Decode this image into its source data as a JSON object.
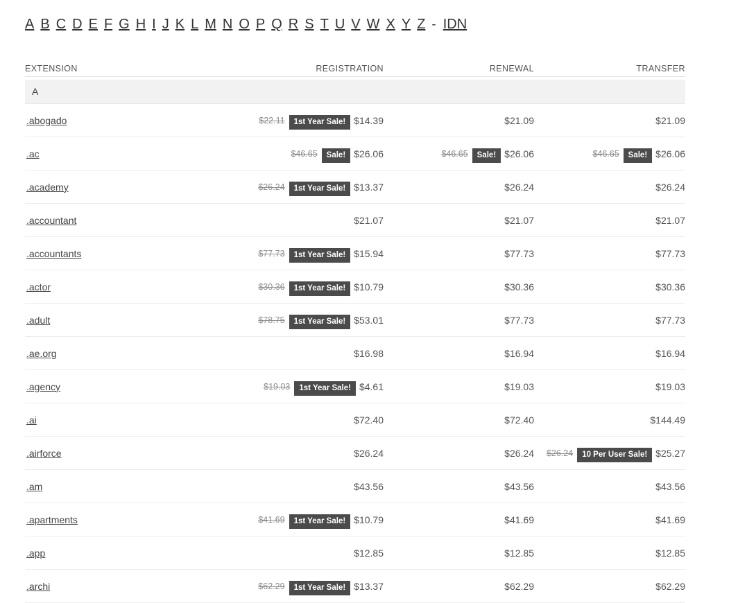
{
  "alpha_nav": {
    "letters": [
      "A",
      "B",
      "C",
      "D",
      "E",
      "F",
      "G",
      "H",
      "I",
      "J",
      "K",
      "L",
      "M",
      "N",
      "O",
      "P",
      "Q",
      "R",
      "S",
      "T",
      "U",
      "V",
      "W",
      "X",
      "Y",
      "Z"
    ],
    "separator": "-",
    "idn_label": "IDN"
  },
  "table": {
    "headers": {
      "extension": "EXTENSION",
      "registration": "REGISTRATION",
      "renewal": "RENEWAL",
      "transfer": "TRANSFER"
    },
    "section_letter": "A",
    "badge_colors": {
      "background": "#4b4b4b",
      "text": "#ffffff"
    },
    "rows": [
      {
        "extension": ".abogado",
        "registration": {
          "old": "$22.11",
          "badge": "1st Year Sale!",
          "price": "$14.39"
        },
        "renewal": {
          "old": null,
          "badge": null,
          "price": "$21.09"
        },
        "transfer": {
          "old": null,
          "badge": null,
          "price": "$21.09"
        }
      },
      {
        "extension": ".ac",
        "registration": {
          "old": "$46.65",
          "badge": "Sale!",
          "price": "$26.06"
        },
        "renewal": {
          "old": "$46.65",
          "badge": "Sale!",
          "price": "$26.06"
        },
        "transfer": {
          "old": "$46.65",
          "badge": "Sale!",
          "price": "$26.06"
        }
      },
      {
        "extension": ".academy",
        "registration": {
          "old": "$26.24",
          "badge": "1st Year Sale!",
          "price": "$13.37"
        },
        "renewal": {
          "old": null,
          "badge": null,
          "price": "$26.24"
        },
        "transfer": {
          "old": null,
          "badge": null,
          "price": "$26.24"
        }
      },
      {
        "extension": ".accountant",
        "registration": {
          "old": null,
          "badge": null,
          "price": "$21.07"
        },
        "renewal": {
          "old": null,
          "badge": null,
          "price": "$21.07"
        },
        "transfer": {
          "old": null,
          "badge": null,
          "price": "$21.07"
        }
      },
      {
        "extension": ".accountants",
        "registration": {
          "old": "$77.73",
          "badge": "1st Year Sale!",
          "price": "$15.94"
        },
        "renewal": {
          "old": null,
          "badge": null,
          "price": "$77.73"
        },
        "transfer": {
          "old": null,
          "badge": null,
          "price": "$77.73"
        }
      },
      {
        "extension": ".actor",
        "registration": {
          "old": "$30.36",
          "badge": "1st Year Sale!",
          "price": "$10.79"
        },
        "renewal": {
          "old": null,
          "badge": null,
          "price": "$30.36"
        },
        "transfer": {
          "old": null,
          "badge": null,
          "price": "$30.36"
        }
      },
      {
        "extension": ".adult",
        "registration": {
          "old": "$78.75",
          "badge": "1st Year Sale!",
          "price": "$53.01"
        },
        "renewal": {
          "old": null,
          "badge": null,
          "price": "$77.73"
        },
        "transfer": {
          "old": null,
          "badge": null,
          "price": "$77.73"
        }
      },
      {
        "extension": ".ae.org",
        "registration": {
          "old": null,
          "badge": null,
          "price": "$16.98"
        },
        "renewal": {
          "old": null,
          "badge": null,
          "price": "$16.94"
        },
        "transfer": {
          "old": null,
          "badge": null,
          "price": "$16.94"
        }
      },
      {
        "extension": ".agency",
        "registration": {
          "old": "$19.03",
          "badge": "1st Year Sale!",
          "price": "$4.61"
        },
        "renewal": {
          "old": null,
          "badge": null,
          "price": "$19.03"
        },
        "transfer": {
          "old": null,
          "badge": null,
          "price": "$19.03"
        }
      },
      {
        "extension": ".ai",
        "registration": {
          "old": null,
          "badge": null,
          "price": "$72.40"
        },
        "renewal": {
          "old": null,
          "badge": null,
          "price": "$72.40"
        },
        "transfer": {
          "old": null,
          "badge": null,
          "price": "$144.49"
        }
      },
      {
        "extension": ".airforce",
        "registration": {
          "old": null,
          "badge": null,
          "price": "$26.24"
        },
        "renewal": {
          "old": null,
          "badge": null,
          "price": "$26.24"
        },
        "transfer": {
          "old": "$26.24",
          "badge": "10 Per User Sale!",
          "price": "$25.27"
        }
      },
      {
        "extension": ".am",
        "registration": {
          "old": null,
          "badge": null,
          "price": "$43.56"
        },
        "renewal": {
          "old": null,
          "badge": null,
          "price": "$43.56"
        },
        "transfer": {
          "old": null,
          "badge": null,
          "price": "$43.56"
        }
      },
      {
        "extension": ".apartments",
        "registration": {
          "old": "$41.69",
          "badge": "1st Year Sale!",
          "price": "$10.79"
        },
        "renewal": {
          "old": null,
          "badge": null,
          "price": "$41.69"
        },
        "transfer": {
          "old": null,
          "badge": null,
          "price": "$41.69"
        }
      },
      {
        "extension": ".app",
        "registration": {
          "old": null,
          "badge": null,
          "price": "$12.85"
        },
        "renewal": {
          "old": null,
          "badge": null,
          "price": "$12.85"
        },
        "transfer": {
          "old": null,
          "badge": null,
          "price": "$12.85"
        }
      },
      {
        "extension": ".archi",
        "registration": {
          "old": "$62.29",
          "badge": "1st Year Sale!",
          "price": "$13.37"
        },
        "renewal": {
          "old": null,
          "badge": null,
          "price": "$62.29"
        },
        "transfer": {
          "old": null,
          "badge": null,
          "price": "$62.29"
        }
      }
    ]
  }
}
